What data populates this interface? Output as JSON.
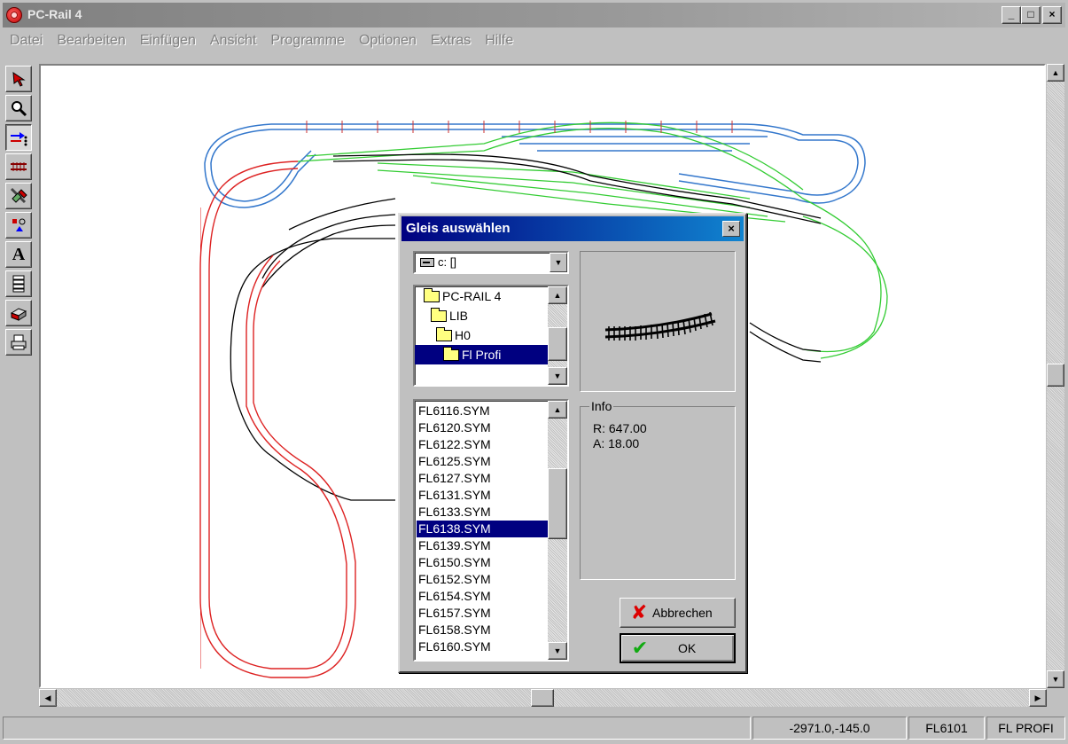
{
  "window": {
    "title": "PC-Rail 4",
    "min": "_",
    "max": "□",
    "close": "×"
  },
  "menu": [
    "Datei",
    "Bearbeiten",
    "Einfügen",
    "Ansicht",
    "Programme",
    "Optionen",
    "Extras",
    "Hilfe"
  ],
  "toolbar": [
    "select-arrow",
    "zoom",
    "track-insert",
    "rail-segment",
    "cut-tool",
    "signals",
    "text",
    "layers",
    "layer-3d",
    "print"
  ],
  "toolbar_text": {
    "text_tool": "A"
  },
  "status": {
    "coords": "-2971.0,-145.0",
    "symbol": "FL6101",
    "library": "FL PROFI"
  },
  "dialog": {
    "title": "Gleis auswählen",
    "close": "×",
    "drive": "c: []",
    "folders": [
      "PC-RAIL 4",
      "LIB",
      "H0",
      "Fl Profi"
    ],
    "selected_folder": 3,
    "files": [
      "FL6116.SYM",
      "FL6120.SYM",
      "FL6122.SYM",
      "FL6125.SYM",
      "FL6127.SYM",
      "FL6131.SYM",
      "FL6133.SYM",
      "FL6138.SYM",
      "FL6139.SYM",
      "FL6150.SYM",
      "FL6152.SYM",
      "FL6154.SYM",
      "FL6157.SYM",
      "FL6158.SYM",
      "FL6160.SYM"
    ],
    "selected_file": 7,
    "info_legend": "Info",
    "info_r": "R: 647.00",
    "info_a": "A: 18.00",
    "cancel": "Abbrechen",
    "ok": "OK"
  },
  "colors": {
    "track_blue": "#3377cc",
    "track_green": "#33cc33",
    "track_red": "#dd2222",
    "track_black": "#000000",
    "selection": "#000080"
  }
}
